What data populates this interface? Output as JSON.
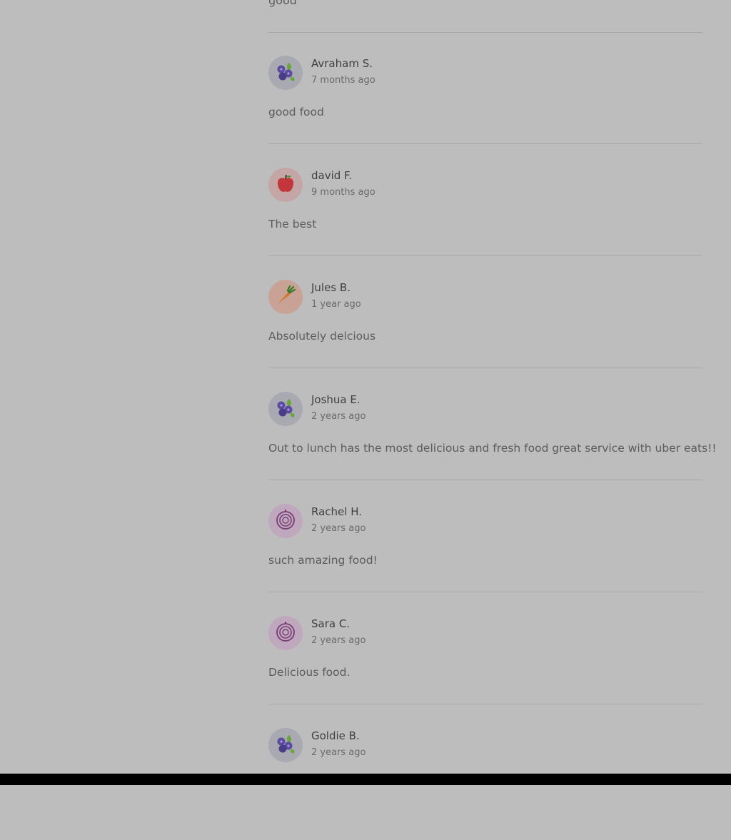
{
  "top_snippet": "good",
  "reviews": [
    {
      "name": "Avraham S.",
      "time": "7 months ago",
      "comment": "good food",
      "avatar": "blueberry-icon",
      "avatar_bg": "#a9a9b1"
    },
    {
      "name": "david F.",
      "time": "9 months ago",
      "comment": "The best",
      "avatar": "apple-icon",
      "avatar_bg": "#c4a6a6"
    },
    {
      "name": "Jules B.",
      "time": "1 year ago",
      "comment": "Absolutely delcious",
      "avatar": "carrot-icon",
      "avatar_bg": "#c9a296"
    },
    {
      "name": "Joshua E.",
      "time": "2 years ago",
      "comment": "Out to lunch has the most delicious and fresh food great service with uber eats!!",
      "avatar": "blueberry-icon",
      "avatar_bg": "#a9a9b1"
    },
    {
      "name": "Rachel H.",
      "time": "2 years ago",
      "comment": "such amazing food!",
      "avatar": "onion-icon",
      "avatar_bg": "#bfa8bd"
    },
    {
      "name": "Sara C.",
      "time": "2 years ago",
      "comment": "Delicious food.",
      "avatar": "onion-icon",
      "avatar_bg": "#bfa8bd"
    },
    {
      "name": "Goldie B.",
      "time": "2 years ago",
      "comment": "",
      "avatar": "blueberry-icon",
      "avatar_bg": "#a9a9b1"
    }
  ]
}
